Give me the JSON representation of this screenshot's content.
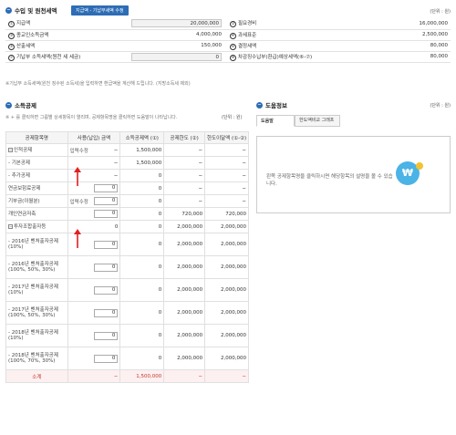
{
  "income": {
    "title": "수입 및 원천세액",
    "button": "지급액 - 기납부세액 수정",
    "unit": "(단위 : 원)",
    "rows": [
      {
        "left_label": "지급액",
        "left_num": "①",
        "left_value": "20,000,000",
        "right_label": "필요경비",
        "right_num": "②",
        "right_value": "16,000,000"
      },
      {
        "left_label": "종교인소득금액",
        "left_num": "③",
        "left_value": "4,000,000",
        "right_label": "과세표준",
        "right_num": "④",
        "right_value": "2,500,000"
      },
      {
        "left_label": "산출세액",
        "left_num": "⑤",
        "left_value": "150,000",
        "right_label": "결정세액",
        "right_num": "⑥",
        "right_value": "80,000"
      },
      {
        "left_label": "기납부 소득세액(원천 세 세금)",
        "left_num": "⑦",
        "left_value": "0",
        "right_label": "차감징수납부(환급)예상세액(⑥-⑦)",
        "right_num": "⑧",
        "right_value": "80,000"
      }
    ],
    "note": "※기납부 소득세액(원천 징수된 소득세)을 입력하면 환급액을 계산해 드립니다. (지방소득세 제외)"
  },
  "deduction": {
    "title": "소득공제",
    "unit": "(단위 : 원)",
    "note": "※ + 를 클릭하면 그룹별 상세항목이 열리며, 공제항목명을 클릭하면 도움말이 나타납니다.",
    "headers": [
      "공제항목명",
      "사용(납입) 금액",
      "소득공제액 (①)",
      "공제한도 (②)",
      "한도이달액 (①-②)"
    ],
    "rows": [
      {
        "label": "인적공제",
        "minus": "−",
        "mid": "입력수정",
        "c1": "−",
        "c2": "1,500,000",
        "c3": "−",
        "c4": "−"
      },
      {
        "label": "- 기본공제",
        "mid": "",
        "c1": "−",
        "c2": "1,500,000",
        "c3": "−",
        "c4": "−"
      },
      {
        "label": "- 추가공제",
        "mid": "",
        "c1": "−",
        "c2": "0",
        "c3": "−",
        "c4": "−"
      },
      {
        "label": "연금보험료공제",
        "mid": "",
        "c1": "0",
        "c2": "0",
        "c3": "−",
        "c4": "−",
        "box": true
      },
      {
        "label": "기부금(이월분)",
        "mid": "입력수정",
        "c1": "0",
        "c2": "0",
        "c3": "−",
        "c4": "−",
        "box": true
      },
      {
        "label": "개인연금저축",
        "mid": "",
        "c1": "0",
        "c2": "0",
        "c3": "720,000",
        "c4": "720,000",
        "box": true
      },
      {
        "label": "투자조합출자등",
        "minus": "−",
        "mid": "",
        "c1": "0",
        "c2": "0",
        "c3": "2,000,000",
        "c4": "2,000,000"
      },
      {
        "label": "- 2016년 벤처출자공제 (10%)",
        "mid": "",
        "c1": "0",
        "c2": "0",
        "c3": "2,000,000",
        "c4": "2,000,000",
        "box": true,
        "tall": true
      },
      {
        "label": "- 2016년 벤처출자공제 (100%, 50%, 30%)",
        "mid": "",
        "c1": "0",
        "c2": "0",
        "c3": "2,000,000",
        "c4": "2,000,000",
        "box": true,
        "tall": true
      },
      {
        "label": "- 2017년 벤처출자공제 (10%)",
        "mid": "",
        "c1": "0",
        "c2": "0",
        "c3": "2,000,000",
        "c4": "2,000,000",
        "box": true,
        "tall": true
      },
      {
        "label": "- 2017년 벤처출자공제 (100%, 50%, 30%)",
        "mid": "",
        "c1": "0",
        "c2": "0",
        "c3": "2,000,000",
        "c4": "2,000,000",
        "box": true,
        "tall": true
      },
      {
        "label": "- 2018년 벤처출자공제 (10%)",
        "mid": "",
        "c1": "0",
        "c2": "0",
        "c3": "2,000,000",
        "c4": "2,000,000",
        "box": true,
        "tall": true
      },
      {
        "label": "- 2018년 벤처출자공제 (100%, 70%, 30%)",
        "mid": "",
        "c1": "0",
        "c2": "0",
        "c3": "2,000,000",
        "c4": "2,000,000",
        "box": true,
        "tall": true
      }
    ],
    "total": {
      "label": "소계",
      "c1": "−",
      "c2": "1,500,000",
      "c3": "−",
      "c4": "−"
    }
  },
  "help": {
    "title": "도움정보",
    "unit": "(단위 : 원)",
    "tabs": [
      "도움말",
      "한도액비교 그래프"
    ],
    "message": "왼쪽 공제항목명을 클릭하시면 해당항목의 설명을 볼 수 있습니다.",
    "icon_symbol": "₩"
  },
  "colors": {
    "accent": "#2d6db5",
    "arrow": "#e02020"
  }
}
